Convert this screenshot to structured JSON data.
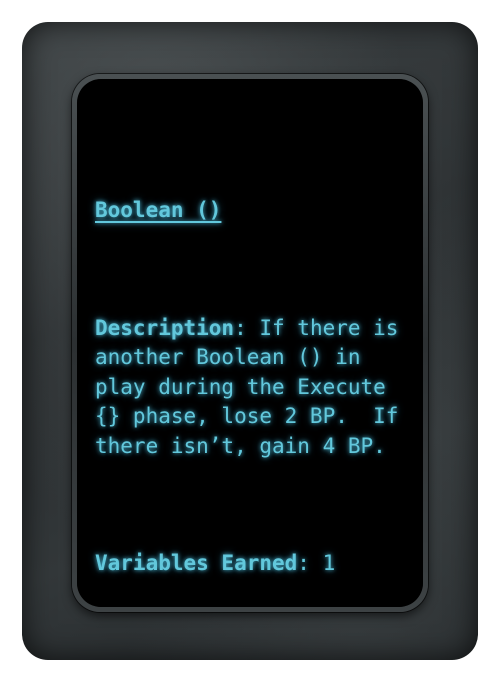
{
  "card": {
    "title": "Boolean ()",
    "description_label": "Description",
    "description_sep": ": ",
    "description_text": "If there is another Boolean () in play during the Execute {} phase, lose 2 BP.  If there isn’t, gain 4 BP.",
    "variables_label": "Variables Earned",
    "variables_sep": ": ",
    "variables_value": "1"
  },
  "colors": {
    "text": "#62c8dc",
    "screen": "#000000",
    "frame": "#33383a"
  }
}
